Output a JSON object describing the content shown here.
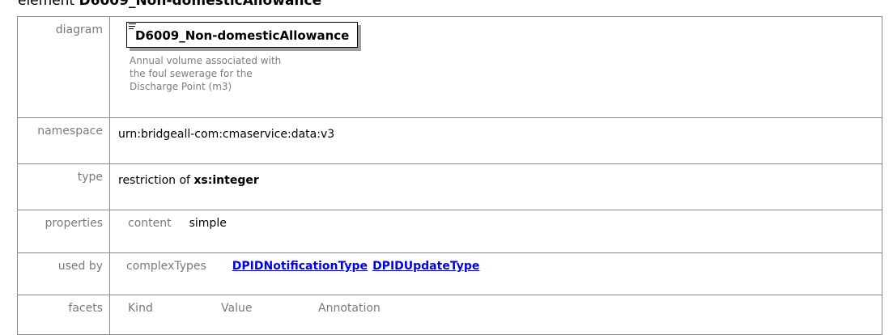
{
  "heading": {
    "prefix": "element ",
    "name": "D6009_Non-domesticAllowance"
  },
  "rows": {
    "diagram": {
      "label": "diagram",
      "element_name": "D6009_Non-domesticAllowance",
      "annotation": "Annual volume associated with the foul sewerage for the Discharge Point (m3)"
    },
    "namespace": {
      "label": "namespace",
      "value": "urn:bridgeall-com:cmaservice:data:v3"
    },
    "type": {
      "label": "type",
      "prefix": "restriction of ",
      "base": "xs:integer"
    },
    "properties": {
      "label": "properties",
      "key": "content",
      "value": "simple"
    },
    "used_by": {
      "label": "used by",
      "key": "complexTypes",
      "links": [
        "DPIDNotificationType",
        "DPIDUpdateType"
      ]
    },
    "facets": {
      "label": "facets",
      "columns": [
        "Kind",
        "Value",
        "Annotation"
      ]
    }
  }
}
